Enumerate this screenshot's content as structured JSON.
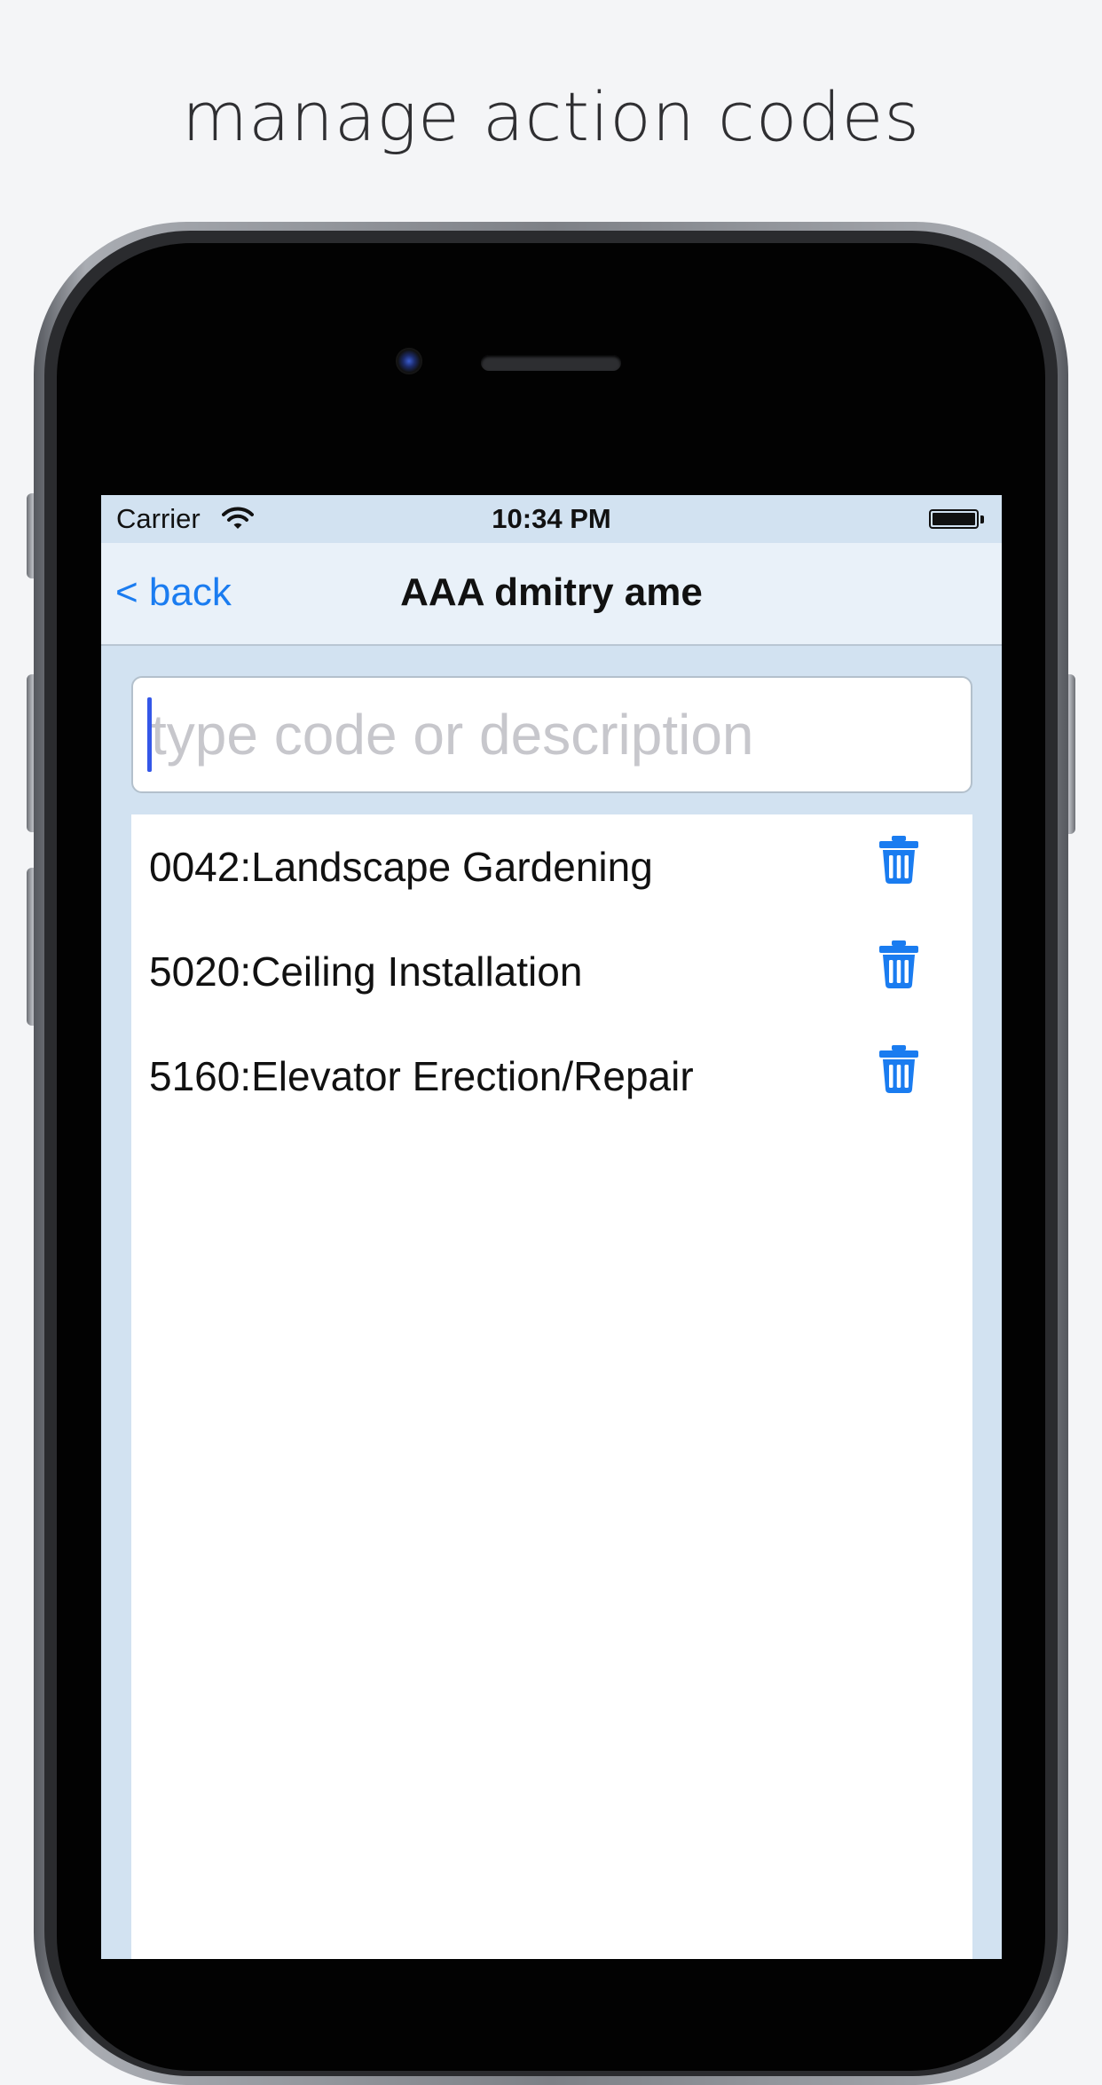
{
  "headline": "manage action codes",
  "status_bar": {
    "carrier": "Carrier",
    "time": "10:34 PM"
  },
  "nav": {
    "back_label": "< back",
    "title": "AAA dmitry ame"
  },
  "search": {
    "placeholder": "type code or description",
    "value": ""
  },
  "codes": [
    {
      "label": "0042:Landscape Gardening"
    },
    {
      "label": "5020:Ceiling Installation"
    },
    {
      "label": "5160:Elevator Erection/Repair"
    }
  ],
  "colors": {
    "accent": "#1a7cf0",
    "screen_background": "#d2e2f1",
    "nav_background": "#e9f1f9",
    "caret": "#3457e8"
  },
  "icons": {
    "delete": "trash-icon",
    "wifi": "wifi-icon",
    "battery": "battery-icon"
  }
}
